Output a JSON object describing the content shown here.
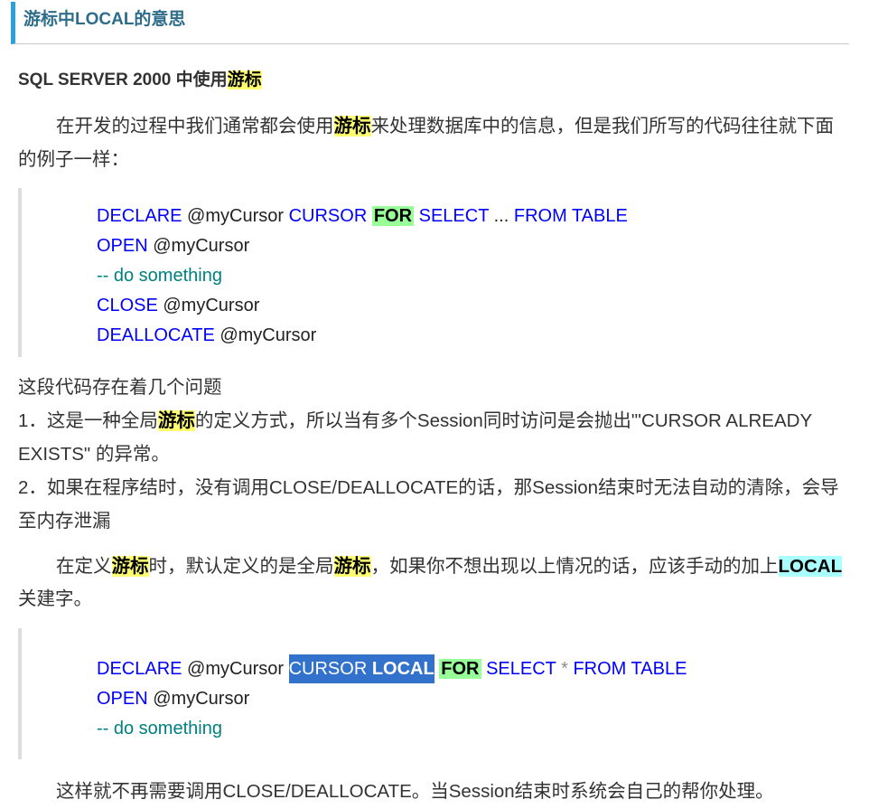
{
  "post": {
    "title": "游标中LOCAL的意思"
  },
  "body": {
    "subheading": {
      "text": "SQL SERVER 2000 中使用",
      "highlight": "游标"
    },
    "intro": {
      "before": "在开发的过程中我们通常都会使用",
      "highlight": "游标",
      "after": "来处理数据库中的信息，但是我们所写的代码往往就下面的例子一样："
    },
    "code_block_1": {
      "line_1": {
        "declare": "DECLARE",
        "var": "@myCursor",
        "cursor": "CURSOR",
        "for": "FOR",
        "select": "SELECT",
        "ellipsis": "...",
        "from": "FROM",
        "table": "TABLE"
      },
      "line_2": {
        "open": "OPEN",
        "var": "@myCursor"
      },
      "line_3": {
        "comment": "-- do something"
      },
      "line_4": {
        "close": "CLOSE",
        "var": "@myCursor"
      },
      "line_5": {
        "deallocate": "DEALLOCATE",
        "var": "@myCursor"
      }
    },
    "issues": {
      "intro": "这段代码存在着几个问题",
      "item_1": {
        "before": "1．这是一种全局",
        "highlight": "游标",
        "after": "的定义方式，所以当有多个Session同时访问是会抛出\"'CURSOR ALREADY EXISTS\" 的异常。"
      },
      "item_2": "2．如果在程序结时，没有调用CLOSE/DEALLOCATE的话，那Session结束时无法自动的清除，会导至内存泄漏"
    },
    "local_tip": {
      "part_1": "在定义",
      "highlight_1": "游标",
      "part_2": "时，默认定义的是全局",
      "highlight_2": "游标",
      "part_3": "，如果你不想出现以上情况的话，应该手动的加上",
      "keyword": "LOCAL",
      "part_4": "关建字。"
    },
    "code_block_2": {
      "line_1": {
        "declare": "DECLARE",
        "var": "@myCursor",
        "selected_cursor": "CURSOR",
        "selected_local": "LOCAL",
        "for": "FOR",
        "select": "SELECT",
        "star": "*",
        "from": "FROM",
        "table": "TABLE"
      },
      "line_2": {
        "open": "OPEN",
        "var": "@myCursor"
      },
      "line_3": {
        "comment": "-- do something"
      }
    },
    "conclusion": "这样就不再需要调用CLOSE/DEALLOCATE。当Session结束时系统会自己的帮你处理。"
  },
  "colors": {
    "title_bar_accent": "#29a1de",
    "title_text": "#2d6d8a",
    "keyword_blue": "#0000ff",
    "comment_teal": "#008080",
    "operator_gray": "#8c8c8c",
    "highlight_yellow": "#ffff70",
    "highlight_green": "#99ff99",
    "highlight_cyan": "#aaffff",
    "selection_blue": "#3271cc"
  }
}
